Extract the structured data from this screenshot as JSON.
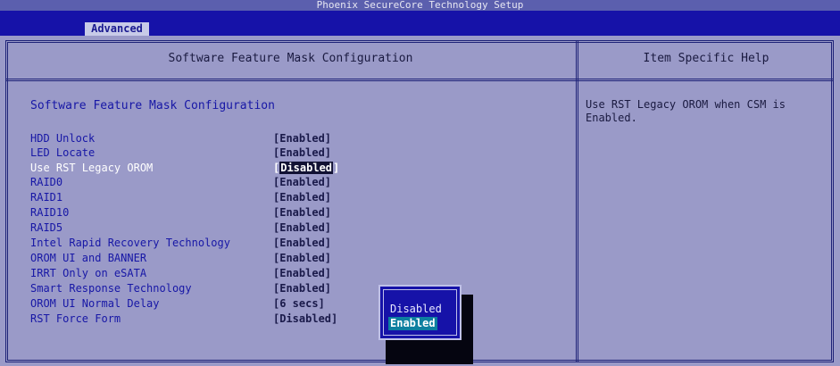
{
  "window": {
    "title": "Phoenix SecureCore Technology Setup"
  },
  "menu": {
    "active_tab": "Advanced"
  },
  "panel": {
    "header": "Software Feature Mask Configuration",
    "section_title": "Software Feature Mask Configuration",
    "items": [
      {
        "label": "HDD Unlock",
        "value": "[Enabled]"
      },
      {
        "label": "LED Locate",
        "value": "[Enabled]"
      },
      {
        "label": "Use RST Legacy OROM",
        "value_prefix": "[",
        "value": "Disabled",
        "value_suffix": "]",
        "selected": true
      },
      {
        "label": "RAID0",
        "value": "[Enabled]"
      },
      {
        "label": "RAID1",
        "value": "[Enabled]"
      },
      {
        "label": "RAID10",
        "value": "[Enabled]"
      },
      {
        "label": "RAID5",
        "value": "[Enabled]"
      },
      {
        "label": "Intel Rapid Recovery Technology",
        "value": "[Enabled]"
      },
      {
        "label": "OROM UI and BANNER",
        "value": "[Enabled]"
      },
      {
        "label": "IRRT Only on eSATA",
        "value": "[Enabled]"
      },
      {
        "label": "Smart Response Technology",
        "value": "[Enabled]"
      },
      {
        "label": "OROM UI Normal Delay",
        "value": "[6 secs]"
      },
      {
        "label": "RST Force Form",
        "value": "[Disabled]"
      }
    ]
  },
  "help": {
    "header": "Item Specific Help",
    "text": "Use RST Legacy OROM when CSM is Enabled."
  },
  "popup": {
    "options": [
      "Disabled",
      "Enabled"
    ],
    "highlighted": "Enabled"
  },
  "colors": {
    "background": "#9a9ac8",
    "menubar": "#1612a8",
    "label": "#1717a6",
    "popup_highlight": "#0d7fa0"
  }
}
